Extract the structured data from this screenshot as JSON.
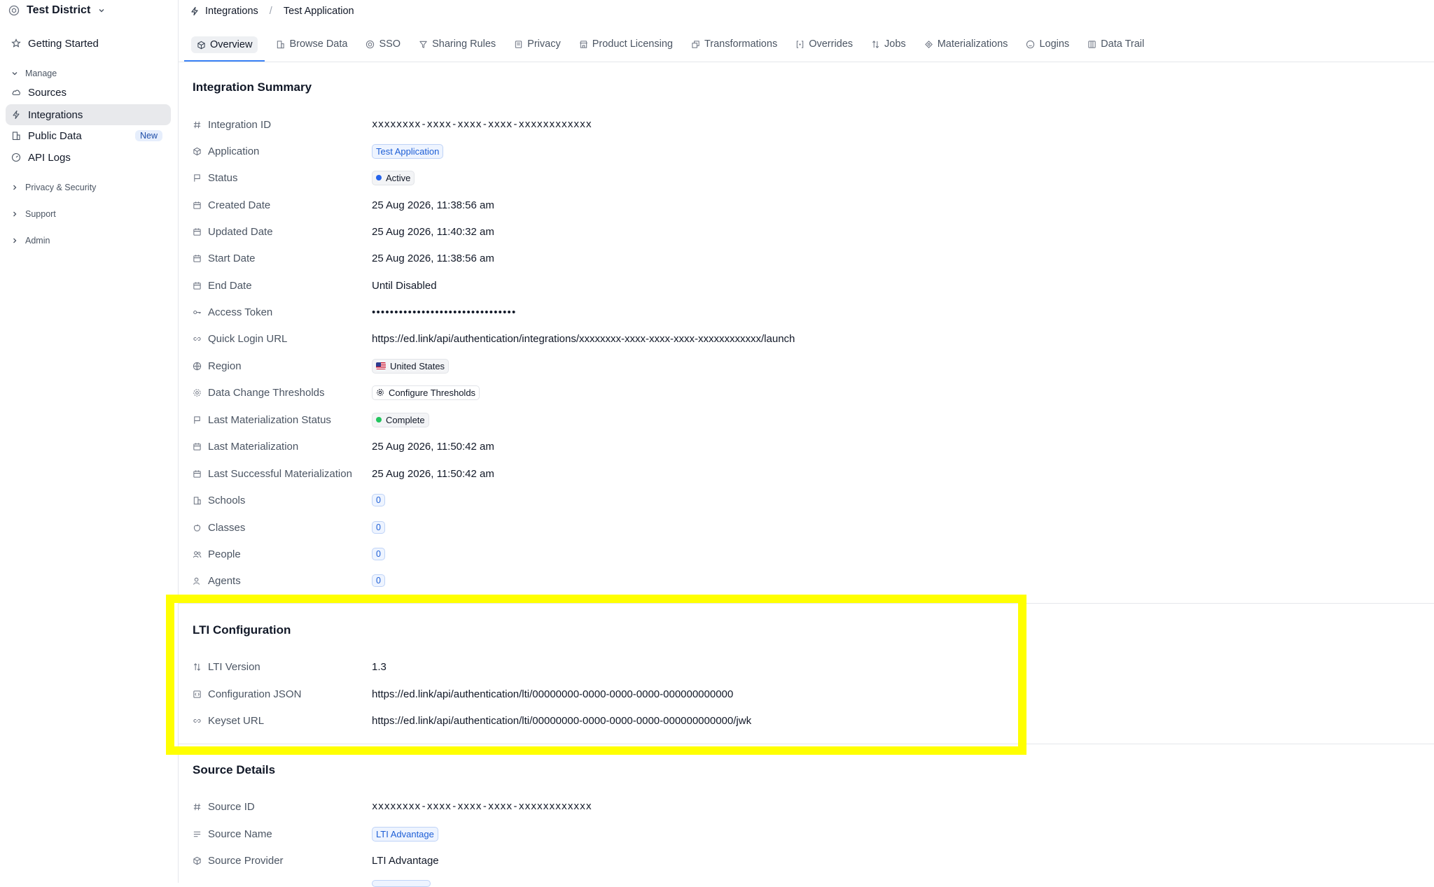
{
  "sidebar": {
    "org_name": "Test District",
    "getting_started": "Getting Started",
    "manage_label": "Manage",
    "items": [
      {
        "label": "Sources"
      },
      {
        "label": "Integrations"
      },
      {
        "label": "Public Data",
        "badge": "New"
      },
      {
        "label": "API Logs"
      }
    ],
    "privacy_security": "Privacy & Security",
    "support": "Support",
    "admin": "Admin"
  },
  "breadcrumb": {
    "root": "Integrations",
    "separator": "/",
    "current": "Test Application"
  },
  "tabs": [
    "Overview",
    "Browse Data",
    "SSO",
    "Sharing Rules",
    "Privacy",
    "Product Licensing",
    "Transformations",
    "Overrides",
    "Jobs",
    "Materializations",
    "Logins",
    "Data Trail"
  ],
  "summary": {
    "title": "Integration Summary",
    "integration_id": {
      "label": "Integration ID",
      "value": "xxxxxxxx-xxxx-xxxx-xxxx-xxxxxxxxxxxx"
    },
    "application": {
      "label": "Application",
      "value": "Test Application"
    },
    "status": {
      "label": "Status",
      "value": "Active"
    },
    "created_date": {
      "label": "Created Date",
      "value": "25 Aug 2026, 11:38:56 am"
    },
    "updated_date": {
      "label": "Updated Date",
      "value": "25 Aug 2026, 11:40:32 am"
    },
    "start_date": {
      "label": "Start Date",
      "value": "25 Aug 2026, 11:38:56 am"
    },
    "end_date": {
      "label": "End Date",
      "value": "Until Disabled"
    },
    "access_token": {
      "label": "Access Token",
      "value": "••••••••••••••••••••••••••••••••"
    },
    "quick_login_url": {
      "label": "Quick Login URL",
      "value": "https://ed.link/api/authentication/integrations/xxxxxxxx-xxxx-xxxx-xxxx-xxxxxxxxxxxx/launch"
    },
    "region": {
      "label": "Region",
      "value": "United States"
    },
    "thresholds": {
      "label": "Data Change Thresholds",
      "value": "Configure Thresholds"
    },
    "last_mat_status": {
      "label": "Last Materialization Status",
      "value": "Complete"
    },
    "last_mat": {
      "label": "Last Materialization",
      "value": "25 Aug 2026, 11:50:42 am"
    },
    "last_success_mat": {
      "label": "Last Successful Materialization",
      "value": "25 Aug 2026, 11:50:42 am"
    },
    "schools": {
      "label": "Schools",
      "value": "0"
    },
    "classes": {
      "label": "Classes",
      "value": "0"
    },
    "people": {
      "label": "People",
      "value": "0"
    },
    "agents": {
      "label": "Agents",
      "value": "0"
    }
  },
  "lti": {
    "title": "LTI Configuration",
    "version": {
      "label": "LTI Version",
      "value": "1.3"
    },
    "config_json": {
      "label": "Configuration JSON",
      "value": "https://ed.link/api/authentication/lti/00000000-0000-0000-0000-000000000000"
    },
    "keyset_url": {
      "label": "Keyset URL",
      "value": "https://ed.link/api/authentication/lti/00000000-0000-0000-0000-000000000000/jwk"
    }
  },
  "source": {
    "title": "Source Details",
    "source_id": {
      "label": "Source ID",
      "value": "xxxxxxxx-xxxx-xxxx-xxxx-xxxxxxxxxxxx"
    },
    "source_name": {
      "label": "Source Name",
      "value": "LTI Advantage"
    },
    "source_provider": {
      "label": "Source Provider",
      "value": "LTI Advantage"
    }
  },
  "colors": {
    "accent": "#3b82f6",
    "status_active": "#2563eb",
    "status_complete": "#22c55e",
    "highlight": "#ffff00"
  }
}
